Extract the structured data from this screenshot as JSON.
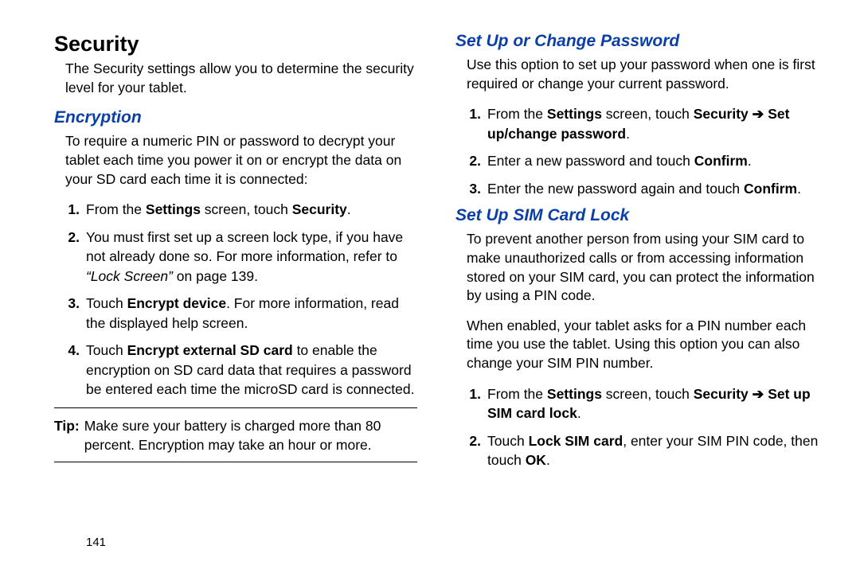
{
  "pageNumber": "141",
  "left": {
    "h1": "Security",
    "intro": "The Security settings allow you to determine the security level for your tablet.",
    "h2": "Encryption",
    "desc": "To require a numeric PIN or password to decrypt your tablet each time you power it on or encrypt the data on your SD card each time it is connected:",
    "steps": {
      "n1": "1.",
      "s1a": "From the ",
      "s1b": "Settings",
      "s1c": " screen, touch ",
      "s1d": "Security",
      "s1e": ".",
      "n2": "2.",
      "s2a": "You must first set up a screen lock type, if you have not already done so. For more information, refer to ",
      "s2b": "“Lock Screen”",
      "s2c": " on page 139.",
      "n3": "3.",
      "s3a": "Touch ",
      "s3b": "Encrypt device",
      "s3c": ". For more information, read the displayed help screen.",
      "n4": "4.",
      "s4a": "Touch ",
      "s4b": "Encrypt external SD card",
      "s4c": " to enable the encryption on SD card data that requires a password be entered each time the microSD card is connected."
    },
    "tipLabel": "Tip:",
    "tipText": "Make sure your battery is charged more than 80 percent. Encryption may take an hour or more."
  },
  "right": {
    "h2a": "Set Up or Change Password",
    "pA": "Use this option to set up your password when one is first required or change your current password.",
    "stepsA": {
      "n1": "1.",
      "s1a": "From the ",
      "s1b": "Settings",
      "s1c": " screen, touch ",
      "s1d": "Security",
      "s1arrow": " ➔ ",
      "s1e": "Set up/change password",
      "s1f": ".",
      "n2": "2.",
      "s2a": "Enter a new password and touch ",
      "s2b": "Confirm",
      "s2c": ".",
      "n3": "3.",
      "s3a": "Enter the new password again and touch ",
      "s3b": "Confirm",
      "s3c": "."
    },
    "h2b": "Set Up SIM Card Lock",
    "pB1": "To prevent another person from using your SIM card to make unauthorized calls or from accessing information stored on your SIM card, you can protect the information by using a PIN code.",
    "pB2": "When enabled, your tablet asks for a PIN number each time you use the tablet. Using this option you can also change your SIM PIN number.",
    "stepsB": {
      "n1": "1.",
      "s1a": "From the ",
      "s1b": "Settings",
      "s1c": " screen, touch ",
      "s1d": "Security",
      "s1arrow": " ➔ ",
      "s1e": "Set up SIM card lock",
      "s1f": ".",
      "n2": "2.",
      "s2a": "Touch ",
      "s2b": "Lock SIM card",
      "s2c": ", enter your SIM PIN code, then touch ",
      "s2d": "OK",
      "s2e": "."
    }
  }
}
